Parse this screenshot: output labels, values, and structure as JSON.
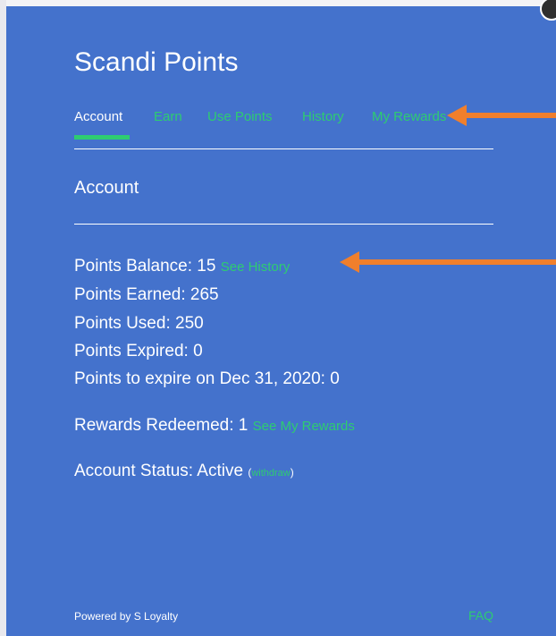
{
  "app": {
    "title": "Scandi Points"
  },
  "tabs": [
    {
      "label": "Account",
      "active": true
    },
    {
      "label": "Earn",
      "active": false
    },
    {
      "label": "Use Points",
      "active": false
    },
    {
      "label": "History",
      "active": false
    },
    {
      "label": "My Rewards",
      "active": false
    }
  ],
  "account": {
    "heading": "Account",
    "points_balance_label": "Points Balance: 15",
    "see_history_link": "See History",
    "points_earned": "Points Earned: 265",
    "points_used": "Points Used: 250",
    "points_expired": "Points Expired: 0",
    "points_to_expire": "Points to expire on Dec 31, 2020: 0",
    "rewards_redeemed_label": "Rewards Redeemed: 1",
    "see_my_rewards_link": "See My Rewards",
    "account_status_label": "Account Status: Active",
    "paren_open": "(",
    "withdraw_link": "withdraw",
    "paren_close": ")"
  },
  "footer": {
    "powered_by": "Powered by S Loyalty",
    "faq_link": "FAQ"
  },
  "colors": {
    "panel_background": "#4472cc",
    "link_green": "#2ecc71",
    "annotation_arrow": "#f07f2c"
  },
  "icons": {
    "close": "close-icon"
  }
}
